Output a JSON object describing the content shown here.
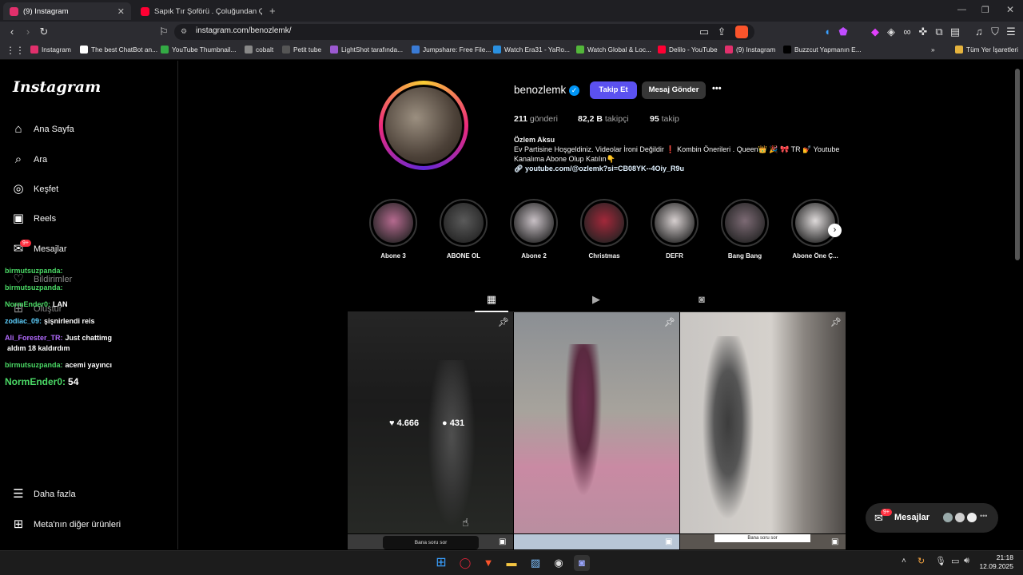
{
  "browser": {
    "tabs": [
      {
        "title": "(9) Instagram",
        "color": "#e1306c"
      },
      {
        "title": "Sapık Tır Şoförü . Çoluğundan Çocuğ",
        "color": "#ff0033"
      }
    ],
    "new_tab": "+",
    "url": "instagram.com/benozlemk/",
    "bookmarks": [
      {
        "label": "Instagram",
        "color": "#e1306c"
      },
      {
        "label": "The best ChatBot an...",
        "color": "#ffffff"
      },
      {
        "label": "YouTube Thumbnail...",
        "color": "#33aa44"
      },
      {
        "label": "cobalt",
        "color": "#888888"
      },
      {
        "label": "Petit tube",
        "color": "#555555"
      },
      {
        "label": "LightShot tarafında...",
        "color": "#9b59d0"
      },
      {
        "label": "Jumpshare: Free File...",
        "color": "#3a7bd5"
      },
      {
        "label": "Watch Era31 - YaRo...",
        "color": "#2a90e0"
      },
      {
        "label": "Watch Global & Loc...",
        "color": "#53b73a"
      },
      {
        "label": "Delilo - YouTube",
        "color": "#ff0033"
      },
      {
        "label": "(9) Instagram",
        "color": "#e1306c"
      },
      {
        "label": "Buzzcut Yapmanın E...",
        "color": "#000000"
      }
    ],
    "all_bookmarks": "Tüm Yer İşaretleri",
    "more_bookmarks": "»"
  },
  "sidebar": {
    "logo": "Instagram",
    "items": [
      {
        "label": "Ana Sayfa",
        "icon": "home-icon",
        "glyph": "⌂"
      },
      {
        "label": "Ara",
        "icon": "search-icon",
        "glyph": "⌕"
      },
      {
        "label": "Keşfet",
        "icon": "compass-icon",
        "glyph": "◎"
      },
      {
        "label": "Reels",
        "icon": "reels-icon",
        "glyph": "▣"
      },
      {
        "label": "Mesajlar",
        "icon": "messenger-icon",
        "glyph": "✉"
      },
      {
        "label": "Bildirimler",
        "icon": "heart-icon",
        "glyph": "♡"
      },
      {
        "label": "Oluştur",
        "icon": "create-icon",
        "glyph": "⊞"
      }
    ],
    "messages_badge": "9+",
    "more": "Daha fazla",
    "meta": "Meta'nın diğer ürünleri"
  },
  "chat_overlay": [
    {
      "user": "birmutsuzpanda:",
      "msg": "",
      "cls": "u"
    },
    {
      "user": "birmutsuzpanda:",
      "msg": "",
      "cls": "u"
    },
    {
      "user": "NormEnder0:",
      "msg": "LAN",
      "cls": "u"
    },
    {
      "user": "zodiac_09:",
      "msg": "şişnirlendi reis",
      "cls": "u2"
    },
    {
      "user": "Ali_Forester_TR:",
      "msg": "Just chattimg",
      "cls": "u3"
    },
    {
      "user": "",
      "msg": "aldım 18 kaldırdım",
      "cls": "u"
    },
    {
      "user": "birmutsuzpanda:",
      "msg": "acemi yayıncı",
      "cls": "u"
    },
    {
      "user": "NormEnder0:",
      "msg": "54",
      "cls": "u"
    }
  ],
  "profile": {
    "username": "benozlemk",
    "follow": "Takip Et",
    "message": "Mesaj Gönder",
    "more": "•••",
    "posts_count": "211",
    "posts_label": "gönderi",
    "followers_count": "82,2 B",
    "followers_label": "takipçi",
    "following_count": "95",
    "following_label": "takip",
    "name": "Özlem Aksu",
    "bio_line1": "Ev Partisine Hoşgeldiniz. Videolar İroni Değildir ❗ Kombin Önerileri . Queen👑 🎉 🎀 TR 💅 Youtube",
    "bio_line2": "Kanalıma Abone Olup Katılın👇",
    "link": "youtube.com/@ozlemk?si=CB08YK--4Oiy_R9u"
  },
  "highlights": [
    {
      "label": "Abone 3",
      "color": "#b56a8f"
    },
    {
      "label": "ABONE OL",
      "color": "#5a5a5a"
    },
    {
      "label": "Abone 2",
      "color": "#c8c0c5"
    },
    {
      "label": "Christmas",
      "color": "#a2283a"
    },
    {
      "label": "DEFR",
      "color": "#d6cfcf"
    },
    {
      "label": "Bang Bang",
      "color": "#7c6a74"
    },
    {
      "label": "Abone Öne Ç...",
      "color": "#dedada"
    }
  ],
  "post_overlay": {
    "likes": "4.666",
    "comments": "431"
  },
  "bottom_posts": {
    "label1": "Bana soru sor",
    "label2": "Bana soru sor"
  },
  "messages_pill": {
    "label": "Mesajlar",
    "badge": "9+"
  },
  "taskbar": {
    "time": "21:18",
    "date": "12.09.2025"
  },
  "colors": {
    "accent": "#5b51f0",
    "verified": "#0095f6",
    "badge": "#ff3040"
  }
}
